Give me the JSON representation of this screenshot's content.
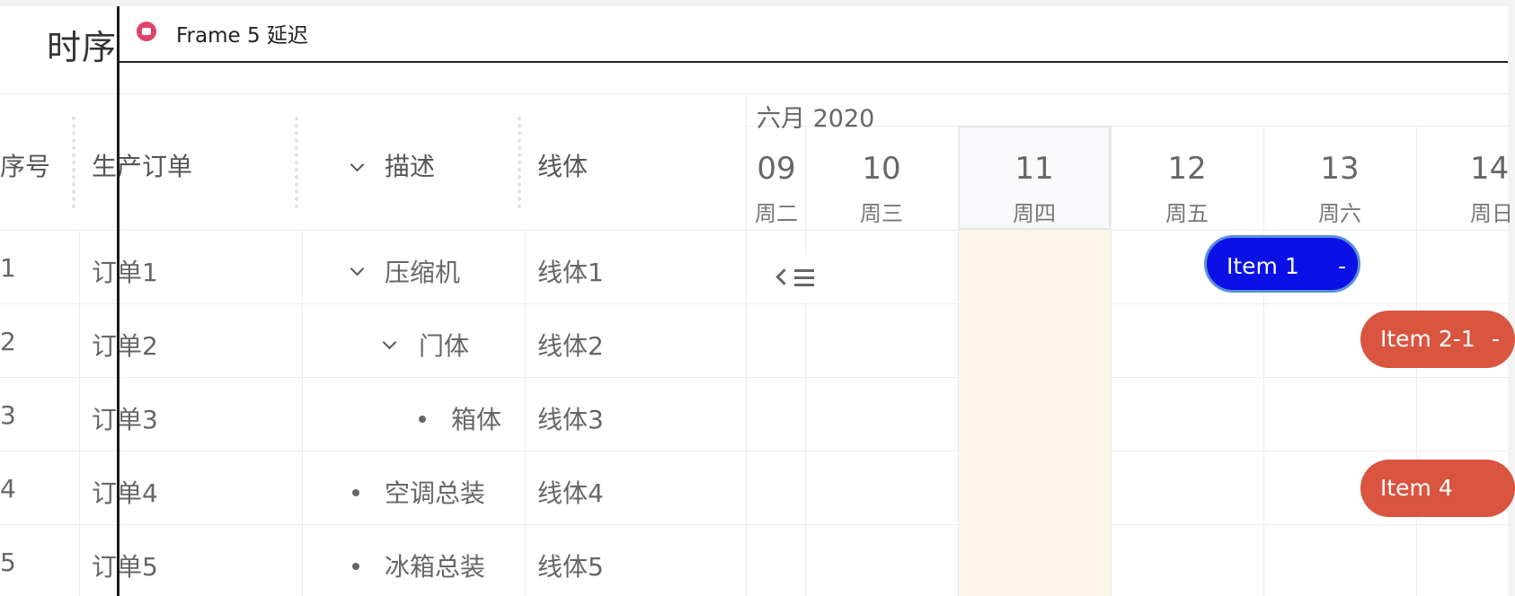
{
  "page": {
    "title": "时序"
  },
  "window": {
    "title": "Frame 5 延迟",
    "icon": "camera-icon"
  },
  "table": {
    "headers": {
      "index": "序号",
      "order": "生产订单",
      "desc": "描述",
      "line": "线体"
    },
    "rows": [
      {
        "index": "1",
        "order": "订单1",
        "desc": "压缩机",
        "line": "线体1"
      },
      {
        "index": "2",
        "order": "订单2",
        "desc": "门体",
        "line": "线体2"
      },
      {
        "index": "3",
        "order": "订单3",
        "desc": "箱体",
        "line": "线体3"
      },
      {
        "index": "4",
        "order": "订单4",
        "desc": "空调总装",
        "line": "线体4"
      },
      {
        "index": "5",
        "order": "订单5",
        "desc": "冰箱总装",
        "line": "线体5"
      }
    ]
  },
  "timeline": {
    "month": "六月 2020",
    "today": "11",
    "days": [
      {
        "num": "09",
        "wk": "周二"
      },
      {
        "num": "10",
        "wk": "周三"
      },
      {
        "num": "11",
        "wk": "周四"
      },
      {
        "num": "12",
        "wk": "周五"
      },
      {
        "num": "13",
        "wk": "周六"
      },
      {
        "num": "14",
        "wk": "周日"
      }
    ],
    "collapse_icon": "collapse-list-icon"
  },
  "items": [
    {
      "label": "Item 1",
      "handle": "-",
      "row": 1,
      "color": "#0a10e6"
    },
    {
      "label": "Item 2-1",
      "handle": "-",
      "row": 2,
      "color": "#d9553f"
    },
    {
      "label": "Item 4",
      "handle": "",
      "row": 4,
      "color": "#d9553f"
    }
  ],
  "colors": {
    "today_bg": "#fdf6e8",
    "item_blue": "#0a10e6",
    "item_red": "#d9553f"
  }
}
